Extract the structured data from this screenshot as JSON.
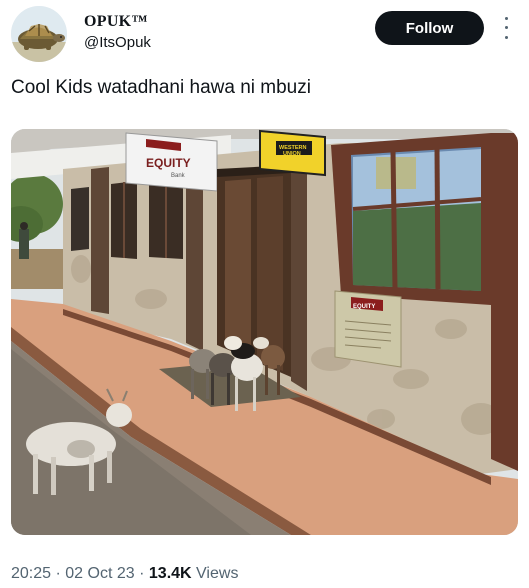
{
  "author": {
    "display_name": "OPUK™",
    "handle": "@ItsOpuk",
    "avatar_icon": "tortoise-avatar-icon"
  },
  "actions": {
    "follow_label": "Follow",
    "more_icon": "more-vertical-icon"
  },
  "tweet": {
    "text": "Cool Kids watadhani hawa ni mbuzi"
  },
  "media": {
    "signs": {
      "equity": "EQUITY",
      "equity_small": "Bank",
      "western_union_line1": "WESTERN",
      "western_union_line2": "UNION",
      "plaque": "EQUITY"
    }
  },
  "meta": {
    "time": "20:25",
    "separator": "·",
    "date": "02 Oct 23",
    "views_count": "13.4K",
    "views_label": "Views"
  },
  "colors": {
    "follow_bg": "#0f1419",
    "meta_gray": "#536471",
    "text": "#0f1419"
  }
}
